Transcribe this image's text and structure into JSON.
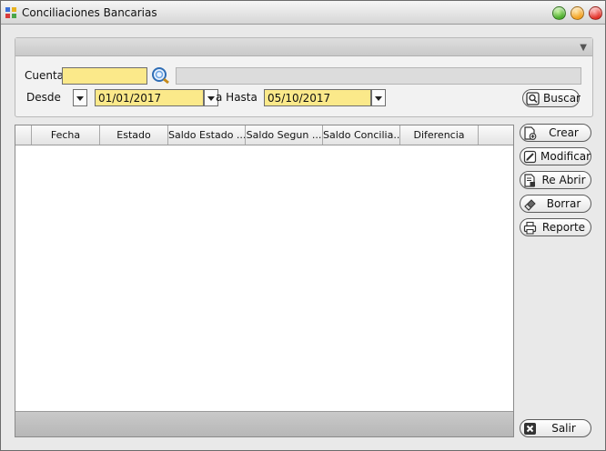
{
  "window": {
    "title": "Conciliaciones Bancarias"
  },
  "filters": {
    "cuenta_label": "Cuenta",
    "cuenta_value": "",
    "desde_label": "Desde",
    "desde_value": "01/01/2017",
    "hasta_label": "a Hasta",
    "hasta_value": "05/10/2017",
    "buscar_label": "Buscar"
  },
  "grid": {
    "columns": [
      "Fecha",
      "Estado",
      "Saldo Estado ...",
      "Saldo Segun ...",
      "Saldo Concilia...",
      "Diferencia"
    ],
    "rows": []
  },
  "actions": {
    "crear": "Crear",
    "modificar": "Modificar",
    "reabrir": "Re Abrir",
    "borrar": "Borrar",
    "reporte": "Reporte",
    "salir": "Salir"
  },
  "icons": {
    "app": "app-icon",
    "lookup": "magnifier-icon",
    "crear": "new-document-icon",
    "modificar": "edit-icon",
    "reabrir": "reopen-document-icon",
    "borrar": "eraser-icon",
    "reporte": "printer-icon",
    "salir": "close-box-icon"
  },
  "colors": {
    "input_highlight": "#fbe98a"
  }
}
